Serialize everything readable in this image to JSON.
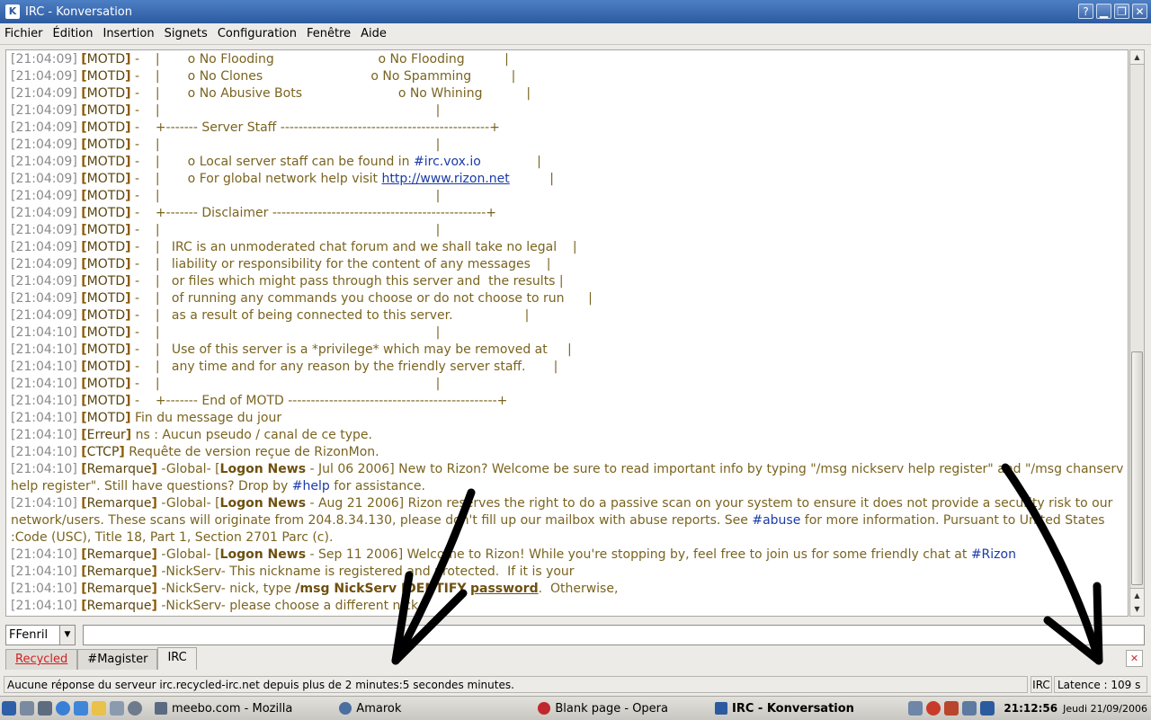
{
  "window": {
    "title": "IRC - Konversation"
  },
  "menu": [
    "Fichier",
    "Édition",
    "Insertion",
    "Signets",
    "Configuration",
    "Fenêtre",
    "Aide"
  ],
  "chat_lines": [
    {
      "ts": "[21:04:09]",
      "tag": "MOTD",
      "text": " -    |       o No Flooding                          o No Flooding          |"
    },
    {
      "ts": "[21:04:09]",
      "tag": "MOTD",
      "text": " -    |       o No Clones                           o No Spamming          |"
    },
    {
      "ts": "[21:04:09]",
      "tag": "MOTD",
      "text": " -    |       o No Abusive Bots                        o No Whining           |"
    },
    {
      "ts": "[21:04:09]",
      "tag": "MOTD",
      "text": " -    |                                                                     |"
    },
    {
      "ts": "[21:04:09]",
      "tag": "MOTD",
      "text": " -    +------- Server Staff ----------------------------------------------+"
    },
    {
      "ts": "[21:04:09]",
      "tag": "MOTD",
      "text": " -    |                                                                     |"
    },
    {
      "ts": "[21:04:09]",
      "tag": "MOTD",
      "pre": " -    |       o Local server staff can be found in ",
      "chan": "#irc.vox.io",
      "post": "              |"
    },
    {
      "ts": "[21:04:09]",
      "tag": "MOTD",
      "pre": " -    |       o For global network help visit ",
      "link": "http://www.rizon.net",
      "post": "          |"
    },
    {
      "ts": "[21:04:09]",
      "tag": "MOTD",
      "text": " -    |                                                                     |"
    },
    {
      "ts": "[21:04:09]",
      "tag": "MOTD",
      "text": " -    +------- Disclaimer -----------------------------------------------+"
    },
    {
      "ts": "[21:04:09]",
      "tag": "MOTD",
      "text": " -    |                                                                     |"
    },
    {
      "ts": "[21:04:09]",
      "tag": "MOTD",
      "text": " -    |   IRC is an unmoderated chat forum and we shall take no legal    |"
    },
    {
      "ts": "[21:04:09]",
      "tag": "MOTD",
      "text": " -    |   liability or responsibility for the content of any messages    |"
    },
    {
      "ts": "[21:04:09]",
      "tag": "MOTD",
      "text": " -    |   or files which might pass through this server and  the results |"
    },
    {
      "ts": "[21:04:09]",
      "tag": "MOTD",
      "text": " -    |   of running any commands you choose or do not choose to run      |"
    },
    {
      "ts": "[21:04:09]",
      "tag": "MOTD",
      "text": " -    |   as a result of being connected to this server.                  |"
    },
    {
      "ts": "[21:04:10]",
      "tag": "MOTD",
      "text": " -    |                                                                     |"
    },
    {
      "ts": "[21:04:10]",
      "tag": "MOTD",
      "text": " -    |   Use of this server is a *privilege* which may be removed at     |"
    },
    {
      "ts": "[21:04:10]",
      "tag": "MOTD",
      "text": " -    |   any time and for any reason by the friendly server staff.       |"
    },
    {
      "ts": "[21:04:10]",
      "tag": "MOTD",
      "text": " -    |                                                                     |"
    },
    {
      "ts": "[21:04:10]",
      "tag": "MOTD",
      "text": " -    +------- End of MOTD ----------------------------------------------+"
    },
    {
      "ts": "[21:04:10]",
      "tag": "MOTD",
      "text": " Fin du message du jour"
    },
    {
      "ts": "[21:04:10]",
      "tag": "Erreur",
      "text": " ns : Aucun pseudo / canal de ce type."
    },
    {
      "ts": "[21:04:10]",
      "tag": "CTCP",
      "text": " Requête de version reçue de RizonMon."
    },
    {
      "ts": "[21:04:10]",
      "tag": "Remarque",
      "pre": " -Global- [",
      "bold": "Logon News",
      "mid": " - Jul 06 2006] New to Rizon? Welcome be sure to read important info by typing \"/msg nickserv help register\" and \"/msg chanserv help register\". Still have questions? Drop by ",
      "chan": "#help",
      "post": " for assistance."
    },
    {
      "ts": "[21:04:10]",
      "tag": "Remarque",
      "pre": " -Global- [",
      "bold": "Logon News",
      "mid": " - Aug 21 2006] Rizon reserves the right to do a passive scan on your system to ensure it does not provide a security risk to our network/users. These scans will originate from 204.8.34.130, please don't fill up our mailbox with abuse reports. See ",
      "chan": "#abuse",
      "post": " for more information. Pursuant to United States :Code (USC), Title 18, Part 1, Section 2701 Parc (c)."
    },
    {
      "ts": "[21:04:10]",
      "tag": "Remarque",
      "pre": " -Global- [",
      "bold": "Logon News",
      "mid": " - Sep 11 2006] Welcome to Rizon! While you're stopping by, feel free to join us for some friendly chat at ",
      "chan": "#Rizon",
      "post": ""
    },
    {
      "ts": "[21:04:10]",
      "tag": "Remarque",
      "text": " -NickServ- This nickname is registered and protected.  If it is your"
    },
    {
      "ts": "[21:04:10]",
      "tag": "Remarque",
      "pre": " -NickServ- nick, type ",
      "bold": "/msg NickServ IDENTIFY",
      "mid": " ",
      "ul": "password",
      "post": ".  Otherwise,"
    },
    {
      "ts": "[21:04:10]",
      "tag": "Remarque",
      "text": " -NickServ- please choose a different nick."
    }
  ],
  "nick": "FFenril",
  "tabs": [
    {
      "label": "Recycled",
      "style": "red"
    },
    {
      "label": "#Magister",
      "style": ""
    },
    {
      "label": "IRC",
      "style": "active"
    }
  ],
  "status": {
    "message": "Aucune réponse du serveur irc.recycled-irc.net depuis plus de 2 minutes:5 secondes minutes.",
    "server": "IRC",
    "latency": "Latence : 109 s"
  },
  "taskbar": {
    "tasks": [
      "meebo.com - Mozilla",
      "Amarok",
      "Blank page - Opera",
      "IRC - Konversation"
    ],
    "clock": "21:12:56",
    "date": "Jeudi  21/09/2006"
  }
}
